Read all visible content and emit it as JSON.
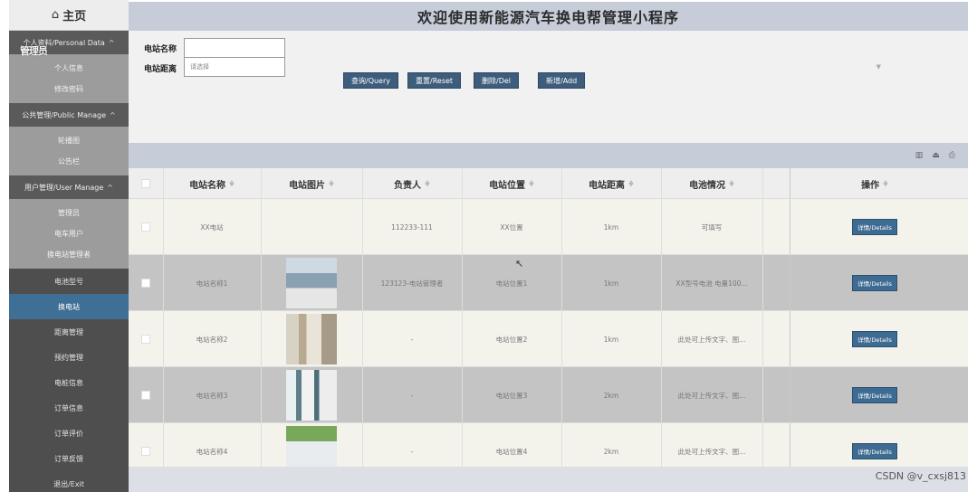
{
  "header": {
    "title": "欢迎使用新能源汽车换电帮管理小程序"
  },
  "sidebar": {
    "brand": "主页",
    "overlay_text": "管理员",
    "groups": [
      {
        "label": "个人资料/Personal Data",
        "items": [
          "个人信息",
          "修改密码"
        ]
      },
      {
        "label": "公共管理/Public Manage",
        "items": [
          "轮播图",
          "公告栏"
        ]
      },
      {
        "label": "用户管理/User Manage",
        "items": [
          "管理员",
          "电车用户",
          "换电站管理者"
        ]
      }
    ],
    "menu": [
      "电池型号",
      "换电站",
      "距离管理",
      "预约管理",
      "电桩信息",
      "订单信息",
      "订单评价",
      "订单反馈",
      "退出/Exit"
    ],
    "active_index": 1
  },
  "search": {
    "name_label": "电站名称",
    "name_value": "",
    "distance_label": "电站距离",
    "distance_placeholder": "请选择",
    "buttons": {
      "query": "查询/Query",
      "reset": "重置/Reset",
      "delete": "删除/Del",
      "add": "新增/Add"
    }
  },
  "table": {
    "columns": [
      "电站名称",
      "电站图片",
      "负责人",
      "电站位置",
      "电站距离",
      "电池情况",
      "操作"
    ],
    "rows": [
      {
        "name": "XX电站",
        "manager": "112233-111",
        "location": "XX位置",
        "distance": "1km",
        "battery": "可填写",
        "action": "详情/Details",
        "has_image": false
      },
      {
        "name": "电站名称1",
        "manager": "123123-电站管理者",
        "location": "电站位置1",
        "distance": "1km",
        "battery": "XX型号电池 电量100...",
        "action": "详情/Details",
        "has_image": true
      },
      {
        "name": "电站名称2",
        "manager": "-",
        "location": "电站位置2",
        "distance": "1km",
        "battery": "此处可上传文字、图...",
        "action": "详情/Details",
        "has_image": true
      },
      {
        "name": "电站名称3",
        "manager": "-",
        "location": "电站位置3",
        "distance": "2km",
        "battery": "此处可上传文字、图...",
        "action": "详情/Details",
        "has_image": true
      },
      {
        "name": "电站名称4",
        "manager": "-",
        "location": "电站位置4",
        "distance": "2km",
        "battery": "此处可上传文字、图...",
        "action": "详情/Details",
        "has_image": true
      }
    ]
  },
  "watermark": "CSDN @v_cxsj813",
  "colors": {
    "active_menu": "#3f6f95",
    "button": "#3e5d7c",
    "header": "#c6ccd8"
  }
}
